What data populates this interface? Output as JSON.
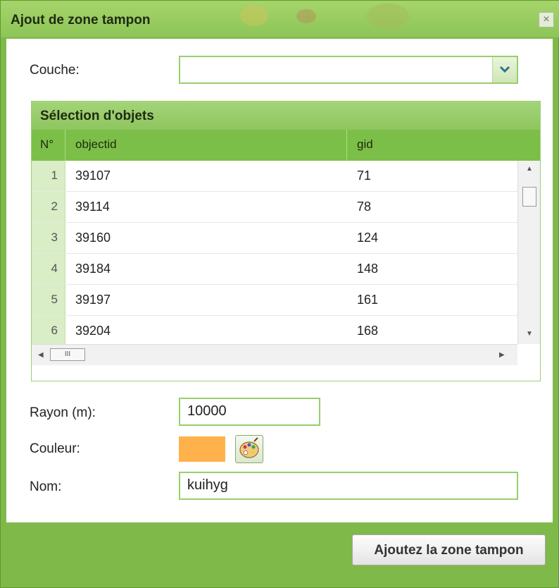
{
  "window": {
    "title": "Ajout de zone tampon",
    "close_glyph": "×"
  },
  "form": {
    "layer_label": "Couche:",
    "layer_value": "",
    "radius_label": "Rayon (m):",
    "radius_value": "10000",
    "color_label": "Couleur:",
    "color_value": "#ffb24c",
    "name_label": "Nom:",
    "name_value": "kuihyg"
  },
  "grid": {
    "title": "Sélection d'objets",
    "columns": [
      "N°",
      "objectid",
      "gid"
    ],
    "rows": [
      {
        "n": "1",
        "objectid": "39107",
        "gid": "71"
      },
      {
        "n": "2",
        "objectid": "39114",
        "gid": "78"
      },
      {
        "n": "3",
        "objectid": "39160",
        "gid": "124"
      },
      {
        "n": "4",
        "objectid": "39184",
        "gid": "148"
      },
      {
        "n": "5",
        "objectid": "39197",
        "gid": "161"
      },
      {
        "n": "6",
        "objectid": "39204",
        "gid": "168"
      }
    ],
    "hscroll_grip": "III"
  },
  "actions": {
    "submit_label": "Ajoutez la zone tampon"
  },
  "icons": [
    "close-icon",
    "chevron-down-icon",
    "palette-icon",
    "scroll-up-arrow-icon",
    "scroll-down-arrow-icon",
    "scroll-left-arrow-icon",
    "scroll-right-arrow-icon"
  ],
  "colors": {
    "frame": "#7fb94a",
    "header": "#7cbf48",
    "accent": "#97cf6e"
  }
}
